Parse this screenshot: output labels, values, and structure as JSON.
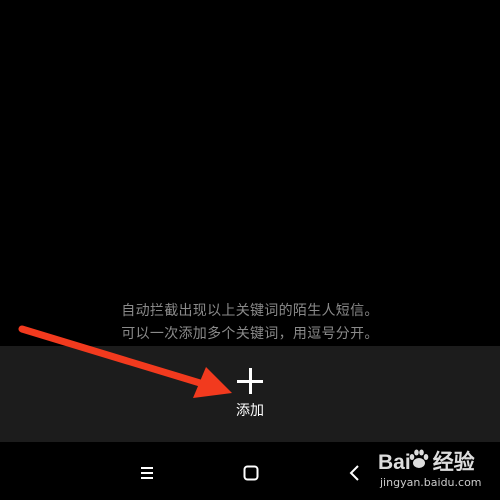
{
  "hint": {
    "line1": "自动拦截出现以上关键词的陌生人短信。",
    "line2": "可以一次添加多个关键词，用逗号分开。"
  },
  "add_button": {
    "icon": "plus-icon",
    "label": "添加"
  },
  "nav": {
    "menu_icon": "menu-icon",
    "home_icon": "home-icon",
    "back_icon": "back-icon"
  },
  "annotation": {
    "color": "#f23a1e"
  },
  "watermark": {
    "logo_left": "Bai",
    "logo_right": "经验",
    "url": "jingyan.baidu.com"
  }
}
